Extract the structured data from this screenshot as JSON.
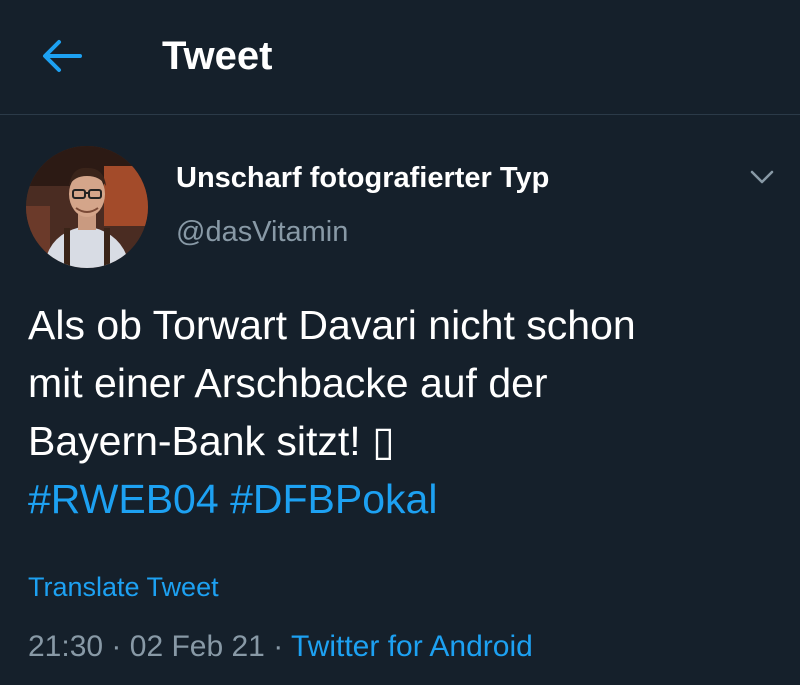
{
  "colors": {
    "background": "#15202b",
    "accent": "#1da1f2",
    "secondary_text": "#8899a6",
    "divider": "#2b3a48"
  },
  "header": {
    "back_icon": "arrow-left-icon",
    "title": "Tweet"
  },
  "tweet": {
    "author": {
      "display_name": "Unscharf fotografierter Typ",
      "handle": "@dasVitamin",
      "avatar_icon": "profile-photo"
    },
    "more_icon": "chevron-down-icon",
    "text_lines": [
      "Als ob Torwart Davari nicht schon",
      "mit einer Arschbacke auf der",
      "Bayern-Bank sitzt! ▯"
    ],
    "hashtags": [
      "#RWEB04",
      "#DFBPokal"
    ],
    "translate_label": "Translate Tweet",
    "time": "21:30",
    "date": "02 Feb 21",
    "separator": "·",
    "source": "Twitter for Android"
  }
}
